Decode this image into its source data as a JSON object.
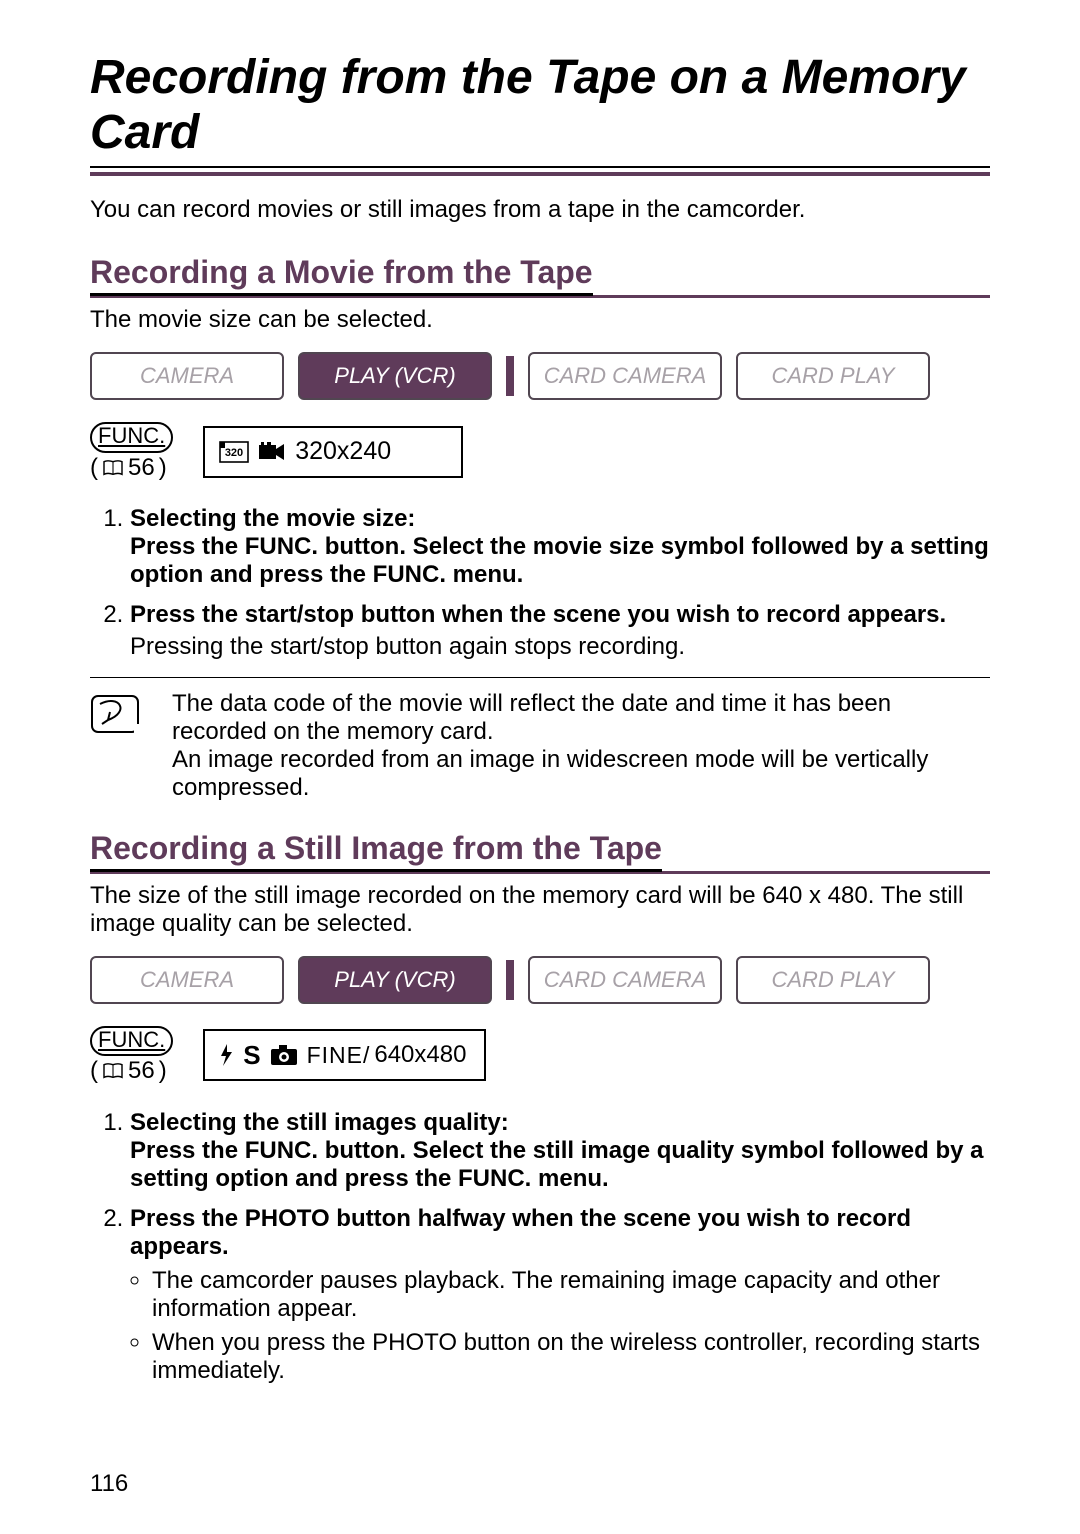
{
  "title": "Recording from the Tape on a Memory Card",
  "intro": "You can record movies or still images from a tape in the camcorder.",
  "page_number": "116",
  "modes": {
    "camera": "CAMERA",
    "play_vcr": "PLAY (VCR)",
    "card_camera": "CARD CAMERA",
    "card_play": "CARD PLAY"
  },
  "func": {
    "label": "FUNC.",
    "ref": "56"
  },
  "movie": {
    "heading": "Recording a Movie from the Tape",
    "sub": "The movie size can be selected.",
    "setting_prefix": "320",
    "setting_value": "320x240",
    "steps": [
      {
        "head": "Selecting the movie size:\nPress the FUNC. button. Select the movie size symbol followed by a setting option and press the FUNC. menu."
      },
      {
        "head": "Press the start/stop button when the scene you wish to record appears.",
        "body": "Pressing the start/stop button again stops recording."
      }
    ],
    "note1": "The data code of the movie will reflect the date and time it has been recorded on the memory card.",
    "note2": "An image recorded from an image in widescreen mode will be vertically compressed."
  },
  "still": {
    "heading": "Recording a Still Image from the Tape",
    "sub": "The size of the still image recorded on the memory card will be 640 x 480. The still image quality can be selected.",
    "setting_prefix": "S",
    "setting_mid": "FINE/",
    "setting_value": "640x480",
    "steps": [
      {
        "head": "Selecting the still images quality:\nPress the FUNC. button. Select the still image quality symbol followed by a setting option and press the FUNC. menu."
      },
      {
        "head": "Press the PHOTO button halfway when the scene you wish to record appears.",
        "bullets": [
          "The camcorder pauses playback. The remaining image capacity and other information appear.",
          "When you press the PHOTO button on the wireless controller, recording starts immediately."
        ]
      }
    ]
  }
}
